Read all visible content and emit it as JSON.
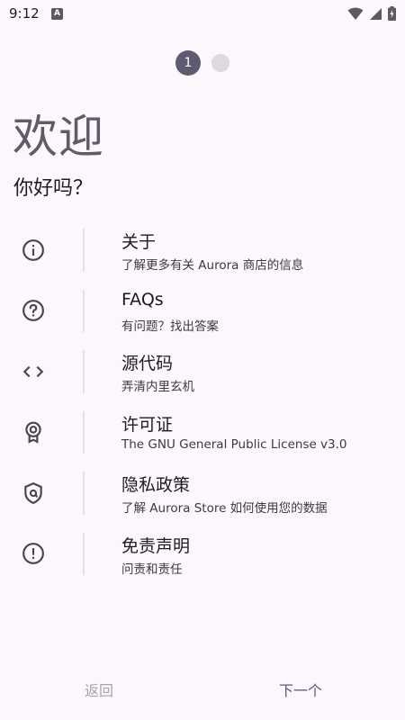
{
  "status_bar": {
    "time": "9:12",
    "notification_icon": "A"
  },
  "pager": {
    "current_page": "1",
    "total_pages": 2
  },
  "welcome": {
    "title": "欢迎",
    "subtitle": "你好吗？"
  },
  "items": [
    {
      "icon": "info-icon",
      "title": "关于",
      "subtitle": "了解更多有关 Aurora 商店的信息"
    },
    {
      "icon": "help-icon",
      "title": "FAQs",
      "subtitle": "有问题？找出答案"
    },
    {
      "icon": "code-icon",
      "title": "源代码",
      "subtitle": "弄清内里玄机"
    },
    {
      "icon": "license-icon",
      "title": "许可证",
      "subtitle": "The GNU General Public License v3.0"
    },
    {
      "icon": "privacy-icon",
      "title": "隐私政策",
      "subtitle": "了解 Aurora Store 如何使用您的数据"
    },
    {
      "icon": "warning-icon",
      "title": "免责声明",
      "subtitle": "问责和责任"
    }
  ],
  "navigation": {
    "back_label": "返回",
    "next_label": "下一个"
  },
  "colors": {
    "background": "#fcf7fc",
    "accent": "#5d5683",
    "title": "#5f5b67"
  }
}
